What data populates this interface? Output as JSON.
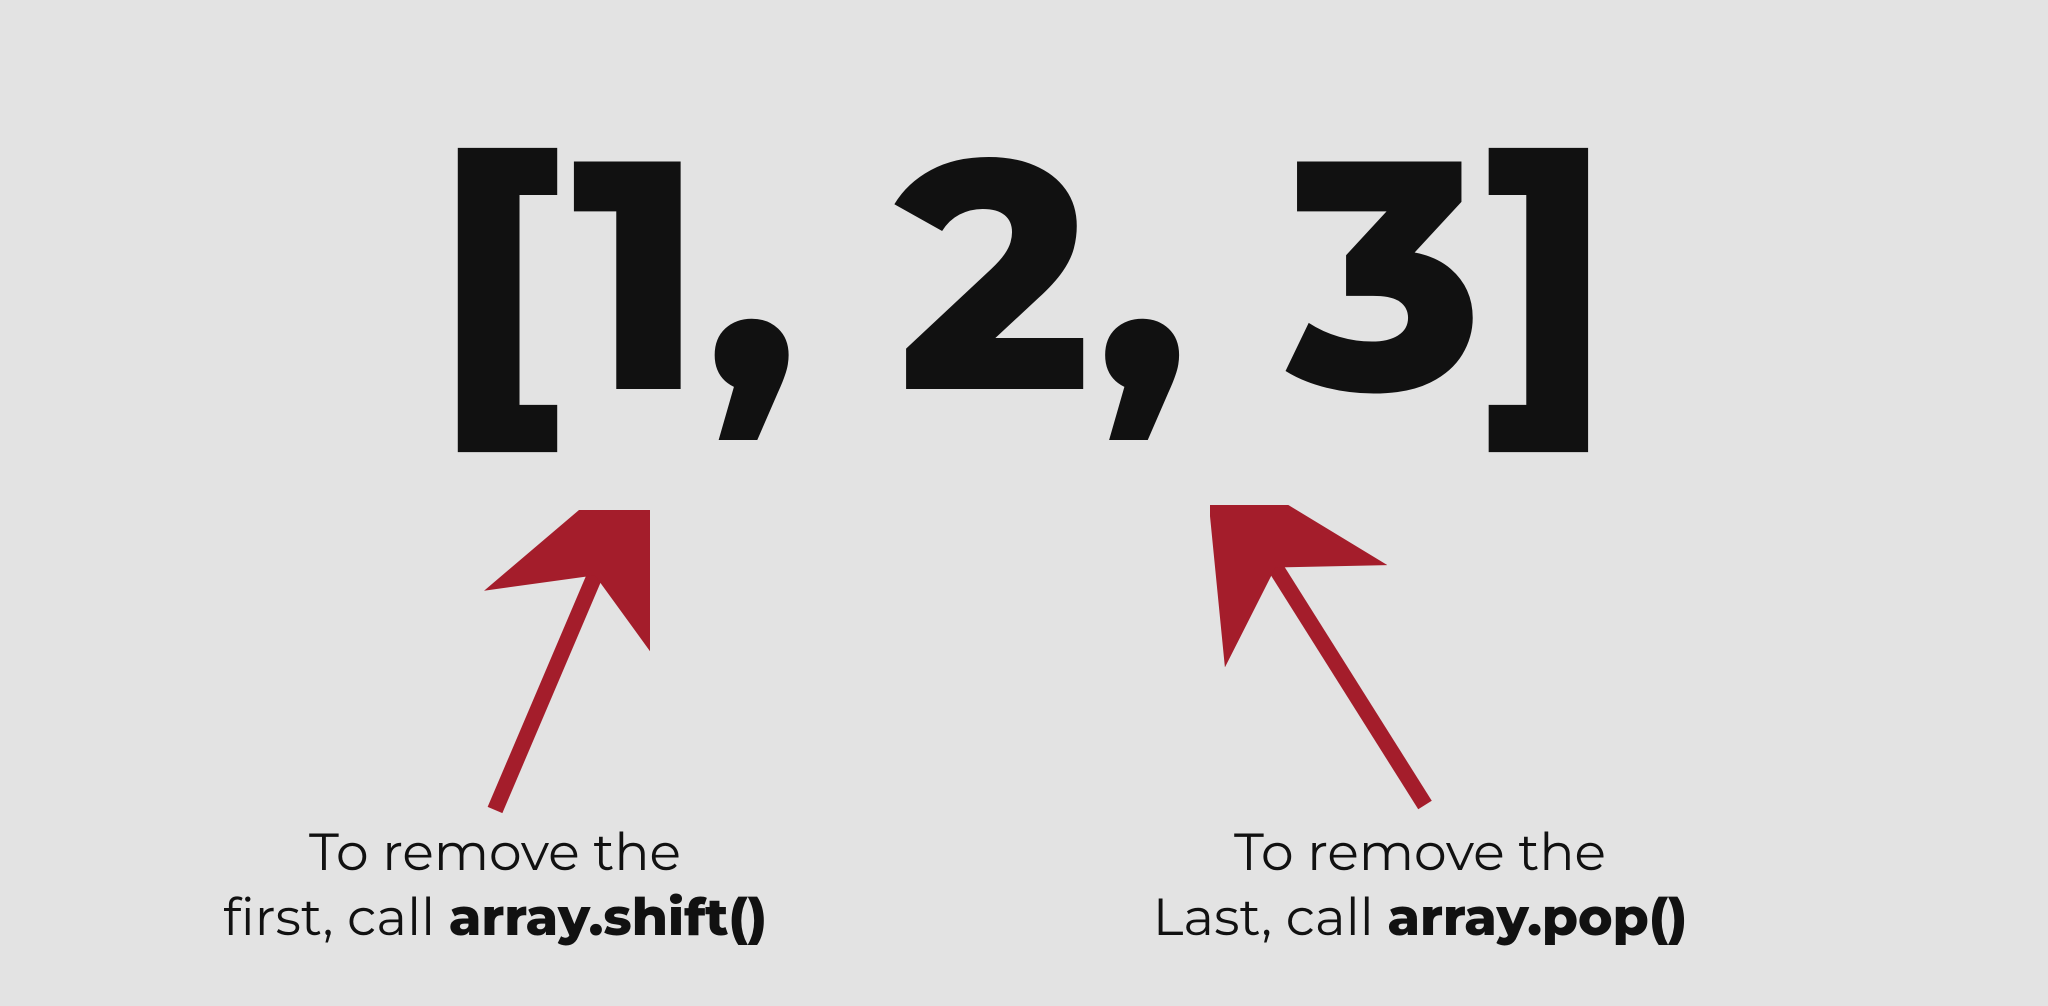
{
  "array_display": "[1, 2, 3]",
  "left_caption": {
    "line1": "To remove the",
    "line2_prefix": "first, call ",
    "line2_bold": "array.shift()"
  },
  "right_caption": {
    "line1": "To remove the",
    "line2_prefix": "Last, call ",
    "line2_bold": "array.pop()"
  },
  "diagram": {
    "array_values": [
      1,
      2,
      3
    ],
    "annotations": [
      {
        "target": "first",
        "instruction": "To remove the first, call array.shift()",
        "method": "array.shift()"
      },
      {
        "target": "last",
        "instruction": "To remove the Last, call array.pop()",
        "method": "array.pop()"
      }
    ],
    "arrow_color": "#a41d2b"
  }
}
